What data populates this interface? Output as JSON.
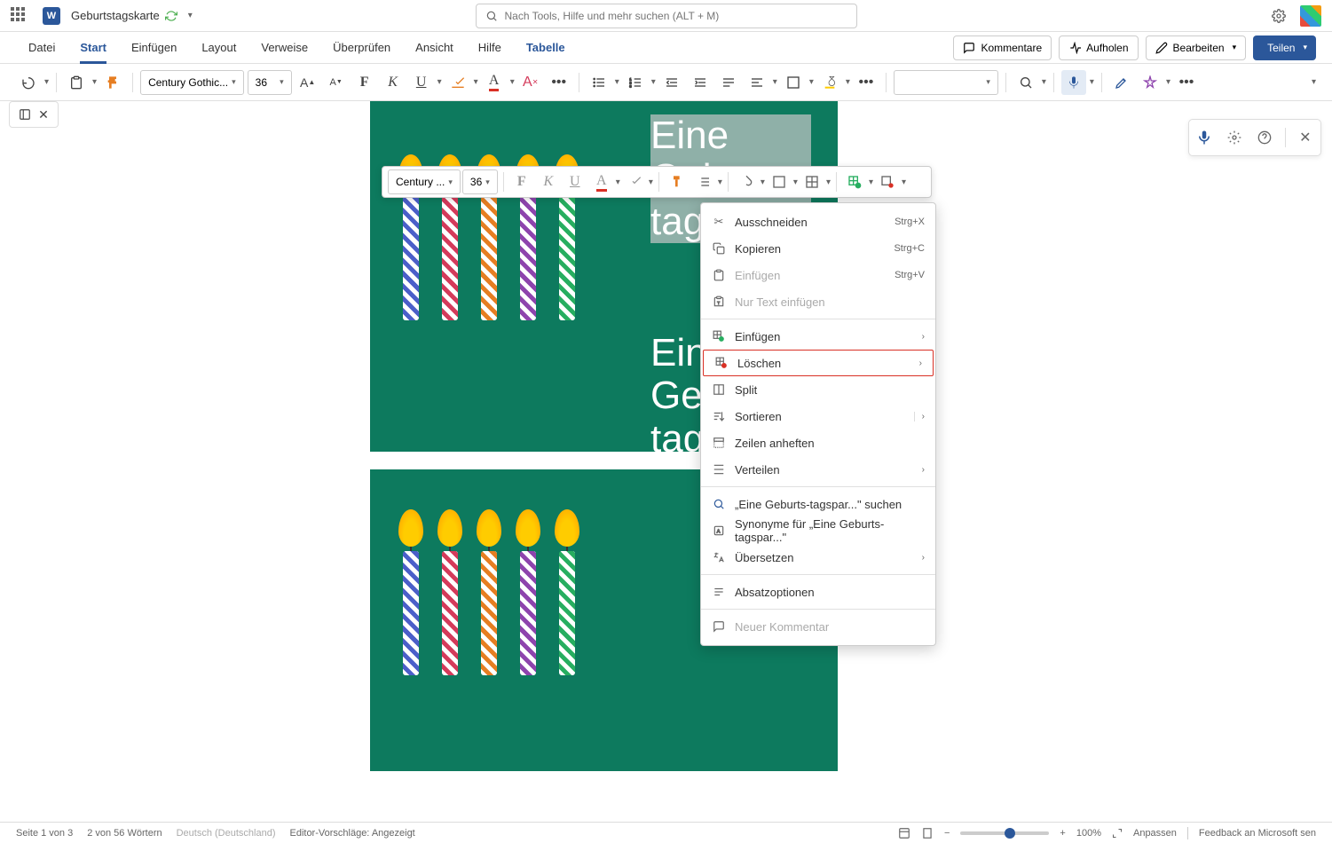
{
  "titlebar": {
    "doc_name": "Geburtstagskarte",
    "search_placeholder": "Nach Tools, Hilfe und mehr suchen (ALT + M)"
  },
  "tabs": {
    "items": [
      "Datei",
      "Start",
      "Einfügen",
      "Layout",
      "Verweise",
      "Überprüfen",
      "Ansicht",
      "Hilfe",
      "Tabelle"
    ],
    "active": 1,
    "right": {
      "comments": "Kommentare",
      "catchup": "Aufholen",
      "edit": "Bearbeiten",
      "share": "Teilen"
    }
  },
  "ribbon": {
    "font_name": "Century Gothic...",
    "font_size": "36"
  },
  "float": {
    "font_name": "Century ...",
    "font_size": "36"
  },
  "document": {
    "text1_l1": "Eine",
    "text1_l2": "Geburts-",
    "text1_l3": "tagsparty",
    "text2_l1": "Eine",
    "text2_l2": "Geburts-",
    "text2_l3": "tagsparty"
  },
  "ctx": {
    "cut": "Ausschneiden",
    "cut_k": "Strg+X",
    "copy": "Kopieren",
    "copy_k": "Strg+C",
    "paste": "Einfügen",
    "paste_k": "Strg+V",
    "paste_text": "Nur Text einfügen",
    "insert": "Einfügen",
    "delete": "Löschen",
    "split": "Split",
    "sort": "Sortieren",
    "pin_rows": "Zeilen anheften",
    "distribute": "Verteilen",
    "search": "„Eine Geburts-tagspar...\" suchen",
    "synonyms": "Synonyme für „Eine Geburts-tagspar...\"",
    "translate": "Übersetzen",
    "paragraph": "Absatzoptionen",
    "new_comment": "Neuer Kommentar"
  },
  "status": {
    "page": "Seite 1 von 3",
    "words": "2 von 56 Wörtern",
    "lang": "Deutsch (Deutschland)",
    "editor": "Editor-Vorschläge: Angezeigt",
    "zoom": "100%",
    "fit": "Anpassen",
    "feedback": "Feedback an Microsoft sen"
  }
}
